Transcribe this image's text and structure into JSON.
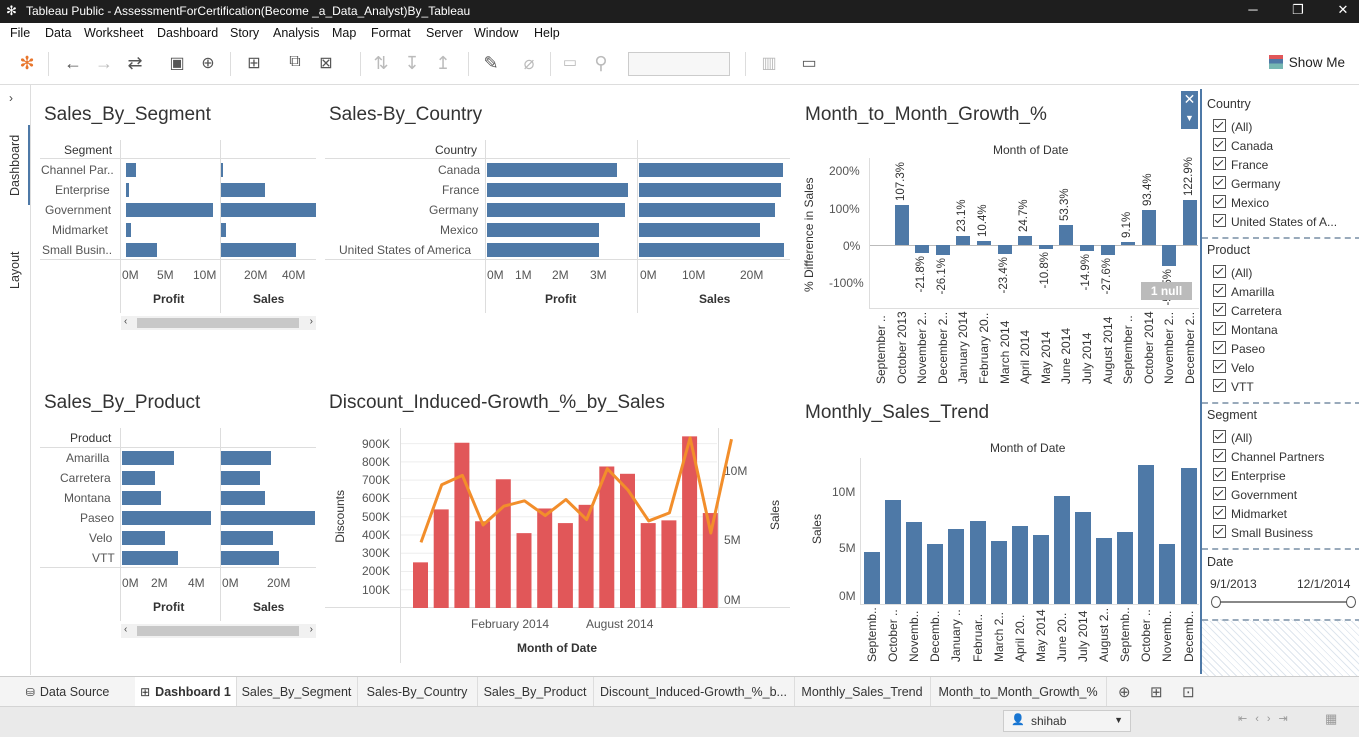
{
  "app": {
    "title": "Tableau Public - AssessmentForCertification(Become _a_Data_Analyst)By_Tableau"
  },
  "menu": [
    "File",
    "Data",
    "Worksheet",
    "Dashboard",
    "Story",
    "Analysis",
    "Map",
    "Format",
    "Server",
    "Window",
    "Help"
  ],
  "toolbar": {
    "show_me": "Show Me"
  },
  "side_tabs": {
    "dashboard": "Dashboard",
    "layout": "Layout"
  },
  "segment": {
    "title": "Sales_By_Segment",
    "header": "Segment",
    "rows": [
      "Channel Par..",
      "Enterprise",
      "Government",
      "Midmarket",
      "Small Busin.."
    ],
    "profit": [
      1.3,
      0.4,
      11.4,
      0.7,
      4.1
    ],
    "sales": [
      0.4,
      11.2,
      24.3,
      1.2,
      19.2
    ],
    "profit_ticks": [
      "0M",
      "5M",
      "10M"
    ],
    "sales_ticks": [
      "20M",
      "40M"
    ],
    "profit_label": "Profit",
    "sales_label": "Sales"
  },
  "country": {
    "title": "Sales-By_Country",
    "header": "Country",
    "rows": [
      "Canada",
      "France",
      "Germany",
      "Mexico",
      "United States of America"
    ],
    "profit": [
      3.5,
      3.8,
      3.7,
      3.0,
      3.0
    ],
    "sales": [
      24.9,
      24.4,
      23.5,
      20.9,
      25.0
    ],
    "profit_ticks": [
      "0M",
      "1M",
      "2M",
      "3M"
    ],
    "sales_ticks": [
      "0M",
      "10M",
      "20M"
    ],
    "profit_label": "Profit",
    "sales_label": "Sales"
  },
  "product": {
    "title": "Sales_By_Product",
    "header": "Product",
    "rows": [
      "Amarilla",
      "Carretera",
      "Montana",
      "Paseo",
      "Velo",
      "VTT"
    ],
    "profit": [
      2.8,
      1.8,
      2.1,
      4.8,
      2.3,
      3.0
    ],
    "sales": [
      17.7,
      13.8,
      15.4,
      33.0,
      18.3,
      20.5
    ],
    "profit_ticks": [
      "0M",
      "2M",
      "4M"
    ],
    "sales_ticks": [
      "0M",
      "20M"
    ],
    "profit_label": "Profit",
    "sales_label": "Sales"
  },
  "discount": {
    "title": "Discount_Induced-Growth_%_by_Sales",
    "ylabel": "Discounts",
    "y2label": "Sales",
    "xlabel": "Month of Date",
    "y_ticks": [
      "900K",
      "800K",
      "700K",
      "600K",
      "500K",
      "400K",
      "300K",
      "200K",
      "100K"
    ],
    "y2_ticks": [
      "10M",
      "5M",
      "0M"
    ],
    "x_ticks": [
      "February 2014",
      "August 2014"
    ],
    "discounts": [
      250,
      540,
      905,
      475,
      705,
      410,
      545,
      465,
      565,
      775,
      735,
      465,
      480,
      940,
      520
    ],
    "sales_m": [
      4.3,
      8.6,
      9.3,
      5.6,
      7.0,
      7.4,
      6.3,
      7.5,
      6.0,
      9.8,
      8.2,
      5.9,
      6.5,
      12.1,
      5.0,
      12.0
    ]
  },
  "mom": {
    "title": "Month_to_Month_Growth_%",
    "header": "Month of Date",
    "ylabel": "% Difference in Sales",
    "y_ticks": [
      "200%",
      "100%",
      "0%",
      "-100%"
    ],
    "months": [
      "September ..",
      "October 2013",
      "November 2..",
      "December 2..",
      "January 2014",
      "February 20..",
      "March 2014",
      "April 2014",
      "May 2014",
      "June 2014",
      "July 2014",
      "August 2014",
      "September ..",
      "October 2014",
      "November 2..",
      "December 2.."
    ],
    "values": [
      null,
      107.3,
      -21.8,
      -26.1,
      23.1,
      10.4,
      -23.4,
      24.7,
      -10.8,
      53.3,
      -14.9,
      -27.6,
      9.1,
      93.4,
      -56.5,
      122.9
    ],
    "labels": [
      "",
      "107.3%",
      "-21.8%",
      "-26.1%",
      "23.1%",
      "10.4%",
      "-23.4%",
      "24.7%",
      "-10.8%",
      "53.3%",
      "-14.9%",
      "-27.6%",
      "9.1%",
      "93.4%",
      "-56.5%",
      "122.9%"
    ],
    "null_badge": "1 null"
  },
  "trend": {
    "title": "Monthly_Sales_Trend",
    "header": "Month of Date",
    "ylabel": "Sales",
    "y_ticks": [
      "10M",
      "5M",
      "0M"
    ],
    "months": [
      "Septemb..",
      "October ..",
      "Novemb..",
      "Decemb..",
      "January ..",
      "Februar..",
      "March 2..",
      "April 20..",
      "May 2014",
      "June 20..",
      "July 2014",
      "August 2..",
      "Septemb..",
      "October ..",
      "Novemb..",
      "Decemb.."
    ],
    "values": [
      4.6,
      9.3,
      7.3,
      5.4,
      6.7,
      7.4,
      5.6,
      7.0,
      6.2,
      9.6,
      8.2,
      5.9,
      6.4,
      12.4,
      5.4,
      12.1
    ]
  },
  "filters": {
    "country": {
      "title": "Country",
      "items": [
        "(All)",
        "Canada",
        "France",
        "Germany",
        "Mexico",
        "United States of A..."
      ]
    },
    "product": {
      "title": "Product",
      "items": [
        "(All)",
        "Amarilla",
        "Carretera",
        "Montana",
        "Paseo",
        "Velo",
        "VTT"
      ]
    },
    "segment": {
      "title": "Segment",
      "items": [
        "(All)",
        "Channel Partners",
        "Enterprise",
        "Government",
        "Midmarket",
        "Small Business"
      ]
    },
    "date": {
      "title": "Date",
      "start": "9/1/2013",
      "end": "12/1/2014"
    }
  },
  "tabs": [
    "Data Source",
    "Dashboard 1",
    "Sales_By_Segment",
    "Sales-By_Country",
    "Sales_By_Product",
    "Discount_Induced-Growth_%_b...",
    "Monthly_Sales_Trend",
    "Month_to_Month_Growth_%"
  ],
  "status": {
    "user": "shihab"
  },
  "colors": {
    "blue": "#4e79a7",
    "red": "#e15759",
    "orange": "#f28e2b"
  }
}
